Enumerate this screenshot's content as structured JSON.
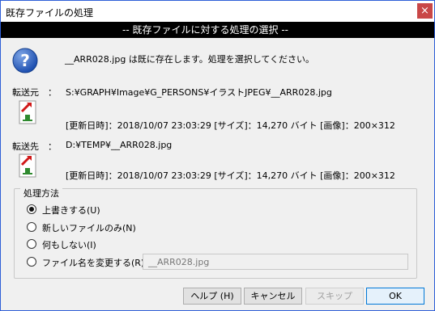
{
  "window": {
    "title": "既存ファイルの処理",
    "close_symbol": "×"
  },
  "banner": "-- 既存ファイルに対する処理の選択 --",
  "message": "__ARR028.jpg は既に存在します。処理を選択してください。",
  "source": {
    "label": "転送元　：",
    "path": "S:¥GRAPH¥Image¥G_PERSONS¥イラストJPEG¥__ARR028.jpg",
    "info": "[更新日時]：2018/10/07 23:03:29 [サイズ]：14,270 バイト [画像]：200×312"
  },
  "dest": {
    "label": "転送先　：",
    "path": "D:¥TEMP¥__ARR028.jpg",
    "info": "[更新日時]：2018/10/07 23:03:29 [サイズ]：14,270 バイト [画像]：200×312"
  },
  "method": {
    "legend": "処理方法",
    "options": [
      {
        "label": "上書きする(U)",
        "selected": true
      },
      {
        "label": "新しいファイルのみ(N)",
        "selected": false
      },
      {
        "label": "何もしない(I)",
        "selected": false
      },
      {
        "label": "ファイル名を変更する(R)",
        "selected": false
      }
    ],
    "rename_value": "__ARR028.jpg"
  },
  "buttons": {
    "help": "ヘルプ (H)",
    "cancel": "キャンセル",
    "skip": "スキップ",
    "ok": "OK"
  },
  "colors": {
    "accent": "#0078d7",
    "banner": "#000000",
    "close": "#c94747"
  },
  "icons": {
    "question": "question-icon",
    "file": "file-arrow-icon",
    "close": "close-icon"
  }
}
